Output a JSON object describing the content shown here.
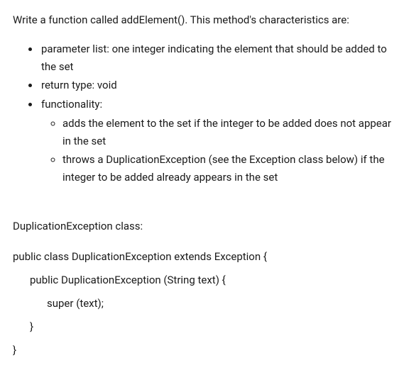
{
  "intro": "Write a function called addElement(). This method's characteristics are:",
  "bullets": {
    "param": "parameter list: one integer indicating the element that should be added to the set",
    "ret": "return type: void",
    "func_label": "functionality:",
    "func_sub1": "adds the element to the set if the integer to be added does not appear in the set",
    "func_sub2": "throws a DuplicationException (see the Exception class below) if the integer to be added already appears in the set"
  },
  "class_label": "DuplicationException class:",
  "code": {
    "l1": "public class DuplicationException extends Exception {",
    "l2": "public DuplicationException (String text) {",
    "l3": "super (text);",
    "l4": "}",
    "l5": "}"
  }
}
